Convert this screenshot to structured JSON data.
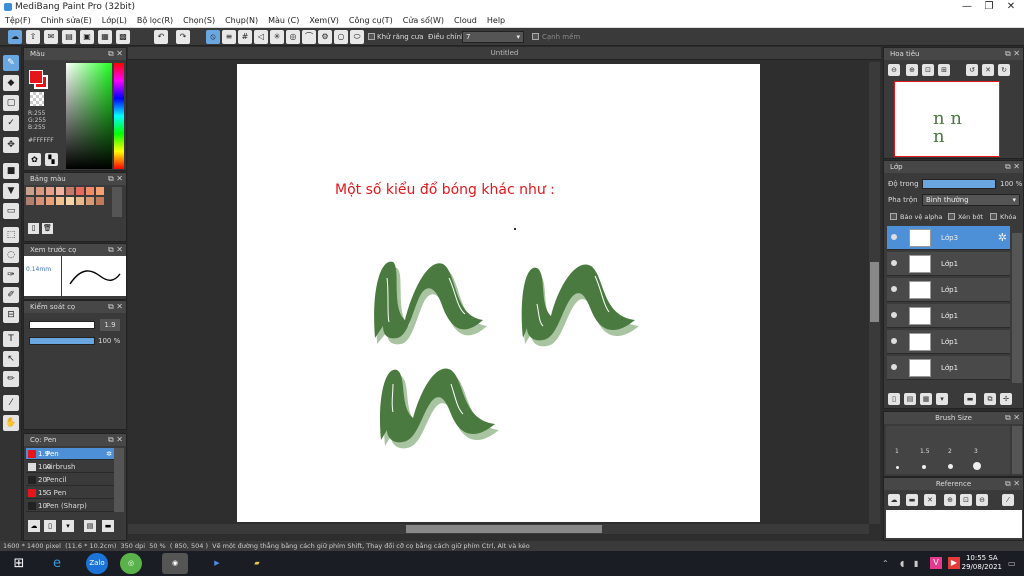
{
  "window": {
    "title": "MediBang Paint Pro (32bit)",
    "controls": [
      "—",
      "❐",
      "✕"
    ]
  },
  "menu": [
    "Tệp(F)",
    "Chỉnh sửa(E)",
    "Lớp(L)",
    "Bộ lọc(R)",
    "Chọn(S)",
    "Chụp(N)",
    "Màu (C)",
    "Xem(V)",
    "Công cụ(T)",
    "Cửa sổ(W)",
    "Cloud",
    "Help"
  ],
  "toolbar": {
    "antialias_label": "Khử răng cưa",
    "correction_label": "Điều chỉnh",
    "correction_value": "7",
    "edge_label": "Cạnh mềm"
  },
  "colors": {
    "accent": "#4d90d8",
    "primary": "#e4161b",
    "ink": "#4a7a3f",
    "shadow": "#a8c4a0"
  },
  "color_panel": {
    "title": "Màu",
    "r": "R:255",
    "g": "G:255",
    "b": "B:255",
    "hex": "#FFFFFF"
  },
  "swatch_panel": {
    "title": "Bảng màu"
  },
  "preview_panel": {
    "title": "Xem trước cọ",
    "size": "0.14mm"
  },
  "control_panel": {
    "title": "Kiểm soát cọ",
    "size_value": "1.9",
    "opacity_value": "100 %"
  },
  "brush_panel": {
    "title": "Cọ: Pen",
    "brushes": [
      {
        "size": "1.9",
        "name": "Pen"
      },
      {
        "size": "100",
        "name": "Airbrush"
      },
      {
        "size": "20",
        "name": "Pencil"
      },
      {
        "size": "15",
        "name": "G Pen"
      },
      {
        "size": "10",
        "name": "Pen (Sharp)"
      }
    ]
  },
  "canvas": {
    "tab_title": "Untitled",
    "heading": "Một số kiểu đổ bóng khác như :"
  },
  "navigator": {
    "title": "Hoa tiêu"
  },
  "layers": {
    "title": "Lớp",
    "opacity_label": "Độ trong",
    "opacity_value": "100 %",
    "blend_label": "Pha trộn",
    "blend_value": "Bình thường",
    "protect_alpha": "Bảo vệ alpha",
    "clipping": "Xén bớt",
    "lock": "Khóa",
    "items": [
      {
        "name": "Lớp3"
      },
      {
        "name": "Lớp1"
      },
      {
        "name": "Lớp1"
      },
      {
        "name": "Lớp1"
      },
      {
        "name": "Lớp1"
      },
      {
        "name": "Lớp1"
      }
    ]
  },
  "brush_size": {
    "title": "Brush Size",
    "sizes": [
      "1",
      "1.5",
      "2",
      "3"
    ]
  },
  "reference": {
    "title": "Reference"
  },
  "status": {
    "dimensions": "1600 * 1400 pixel",
    "physical": "(11.6 * 10.2cm)",
    "dpi": "350 dpi",
    "zoom": "50 %",
    "coords": "( 850, 504 )",
    "hint": "Vẽ một đường thẳng bằng cách giữ phím Shift, Thay đổi cỡ cọ bằng cách giữ phím Ctrl, Alt và kéo"
  },
  "taskbar": {
    "zalo": "Zalo",
    "time": "10:55 SA",
    "date": "29/08/2021"
  }
}
